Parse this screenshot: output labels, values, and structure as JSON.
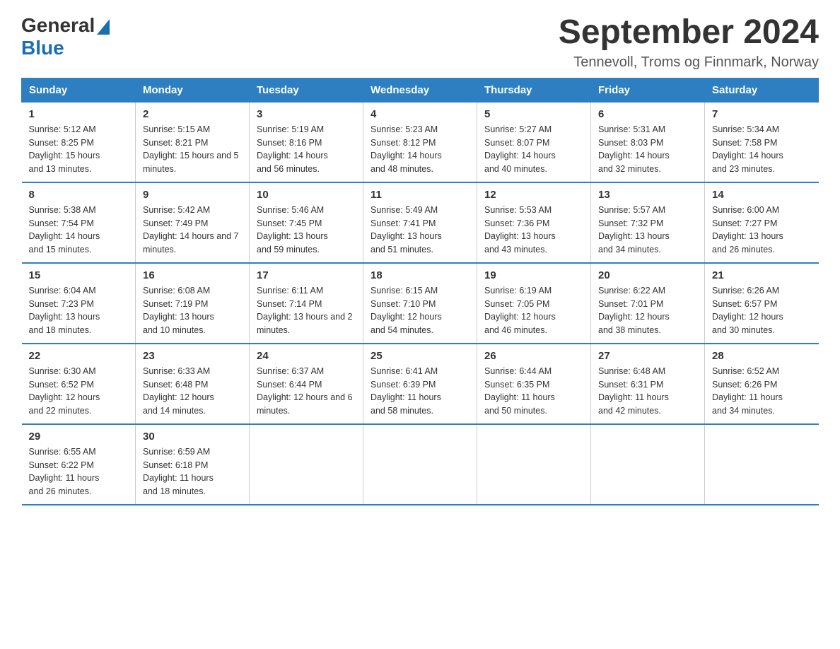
{
  "header": {
    "logo_general": "General",
    "logo_blue": "Blue",
    "title": "September 2024",
    "subtitle": "Tennevoll, Troms og Finnmark, Norway"
  },
  "weekdays": [
    "Sunday",
    "Monday",
    "Tuesday",
    "Wednesday",
    "Thursday",
    "Friday",
    "Saturday"
  ],
  "weeks": [
    [
      {
        "day": "1",
        "sunrise": "5:12 AM",
        "sunset": "8:25 PM",
        "daylight": "15 hours and 13 minutes."
      },
      {
        "day": "2",
        "sunrise": "5:15 AM",
        "sunset": "8:21 PM",
        "daylight": "15 hours and 5 minutes."
      },
      {
        "day": "3",
        "sunrise": "5:19 AM",
        "sunset": "8:16 PM",
        "daylight": "14 hours and 56 minutes."
      },
      {
        "day": "4",
        "sunrise": "5:23 AM",
        "sunset": "8:12 PM",
        "daylight": "14 hours and 48 minutes."
      },
      {
        "day": "5",
        "sunrise": "5:27 AM",
        "sunset": "8:07 PM",
        "daylight": "14 hours and 40 minutes."
      },
      {
        "day": "6",
        "sunrise": "5:31 AM",
        "sunset": "8:03 PM",
        "daylight": "14 hours and 32 minutes."
      },
      {
        "day": "7",
        "sunrise": "5:34 AM",
        "sunset": "7:58 PM",
        "daylight": "14 hours and 23 minutes."
      }
    ],
    [
      {
        "day": "8",
        "sunrise": "5:38 AM",
        "sunset": "7:54 PM",
        "daylight": "14 hours and 15 minutes."
      },
      {
        "day": "9",
        "sunrise": "5:42 AM",
        "sunset": "7:49 PM",
        "daylight": "14 hours and 7 minutes."
      },
      {
        "day": "10",
        "sunrise": "5:46 AM",
        "sunset": "7:45 PM",
        "daylight": "13 hours and 59 minutes."
      },
      {
        "day": "11",
        "sunrise": "5:49 AM",
        "sunset": "7:41 PM",
        "daylight": "13 hours and 51 minutes."
      },
      {
        "day": "12",
        "sunrise": "5:53 AM",
        "sunset": "7:36 PM",
        "daylight": "13 hours and 43 minutes."
      },
      {
        "day": "13",
        "sunrise": "5:57 AM",
        "sunset": "7:32 PM",
        "daylight": "13 hours and 34 minutes."
      },
      {
        "day": "14",
        "sunrise": "6:00 AM",
        "sunset": "7:27 PM",
        "daylight": "13 hours and 26 minutes."
      }
    ],
    [
      {
        "day": "15",
        "sunrise": "6:04 AM",
        "sunset": "7:23 PM",
        "daylight": "13 hours and 18 minutes."
      },
      {
        "day": "16",
        "sunrise": "6:08 AM",
        "sunset": "7:19 PM",
        "daylight": "13 hours and 10 minutes."
      },
      {
        "day": "17",
        "sunrise": "6:11 AM",
        "sunset": "7:14 PM",
        "daylight": "13 hours and 2 minutes."
      },
      {
        "day": "18",
        "sunrise": "6:15 AM",
        "sunset": "7:10 PM",
        "daylight": "12 hours and 54 minutes."
      },
      {
        "day": "19",
        "sunrise": "6:19 AM",
        "sunset": "7:05 PM",
        "daylight": "12 hours and 46 minutes."
      },
      {
        "day": "20",
        "sunrise": "6:22 AM",
        "sunset": "7:01 PM",
        "daylight": "12 hours and 38 minutes."
      },
      {
        "day": "21",
        "sunrise": "6:26 AM",
        "sunset": "6:57 PM",
        "daylight": "12 hours and 30 minutes."
      }
    ],
    [
      {
        "day": "22",
        "sunrise": "6:30 AM",
        "sunset": "6:52 PM",
        "daylight": "12 hours and 22 minutes."
      },
      {
        "day": "23",
        "sunrise": "6:33 AM",
        "sunset": "6:48 PM",
        "daylight": "12 hours and 14 minutes."
      },
      {
        "day": "24",
        "sunrise": "6:37 AM",
        "sunset": "6:44 PM",
        "daylight": "12 hours and 6 minutes."
      },
      {
        "day": "25",
        "sunrise": "6:41 AM",
        "sunset": "6:39 PM",
        "daylight": "11 hours and 58 minutes."
      },
      {
        "day": "26",
        "sunrise": "6:44 AM",
        "sunset": "6:35 PM",
        "daylight": "11 hours and 50 minutes."
      },
      {
        "day": "27",
        "sunrise": "6:48 AM",
        "sunset": "6:31 PM",
        "daylight": "11 hours and 42 minutes."
      },
      {
        "day": "28",
        "sunrise": "6:52 AM",
        "sunset": "6:26 PM",
        "daylight": "11 hours and 34 minutes."
      }
    ],
    [
      {
        "day": "29",
        "sunrise": "6:55 AM",
        "sunset": "6:22 PM",
        "daylight": "11 hours and 26 minutes."
      },
      {
        "day": "30",
        "sunrise": "6:59 AM",
        "sunset": "6:18 PM",
        "daylight": "11 hours and 18 minutes."
      },
      null,
      null,
      null,
      null,
      null
    ]
  ],
  "labels": {
    "sunrise": "Sunrise:",
    "sunset": "Sunset:",
    "daylight": "Daylight:"
  }
}
